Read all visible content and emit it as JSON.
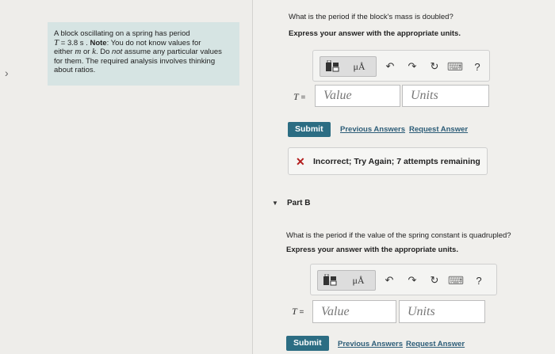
{
  "left": {
    "chevron": "›",
    "note_line1": "A block oscillating on a spring has period",
    "note_T": "T",
    "note_eq": " = 3.8  s . ",
    "note_bold": "Note",
    "note_after_bold": ": You do not know values for",
    "note_line3a": "either ",
    "note_m": "m",
    "note_or": " or ",
    "note_k": "k",
    "note_line3b": ". Do ",
    "note_not": "not",
    "note_line3c": " assume any particular values",
    "note_line4": "for them. The required analysis involves thinking",
    "note_line5": "about ratios."
  },
  "partA": {
    "question": "What is the period if the block's mass is doubled?",
    "instruction": "Express your answer with the appropriate units.",
    "eq_var": "T",
    "eq_sign": " =",
    "value_placeholder": "Value",
    "units_placeholder": "Units",
    "submit": "Submit",
    "previous_answers": "Previous Answers",
    "request_answer": "Request Answer",
    "feedback_icon": "✕",
    "feedback_text": "Incorrect; Try Again; 7 attempts remaining"
  },
  "partB": {
    "caret": "▼",
    "label": "Part B",
    "question": "What is the period if the value of the spring constant is quadrupled?",
    "instruction": "Express your answer with the appropriate units.",
    "eq_var": "T",
    "eq_sign": " =",
    "value_placeholder": "Value",
    "units_placeholder": "Units",
    "submit": "Submit",
    "previous_answers": "Previous Answers",
    "request_answer": "Request Answer"
  },
  "toolbar": {
    "mu_label": "μÅ",
    "undo": "↶",
    "redo": "↷",
    "reset": "↻",
    "keyboard": "⌨",
    "help": "?"
  },
  "colors": {
    "note_bg": "#d6e4e3",
    "submit_bg": "#2c6d83",
    "link": "#2d5d78",
    "error": "#b31d1d"
  }
}
